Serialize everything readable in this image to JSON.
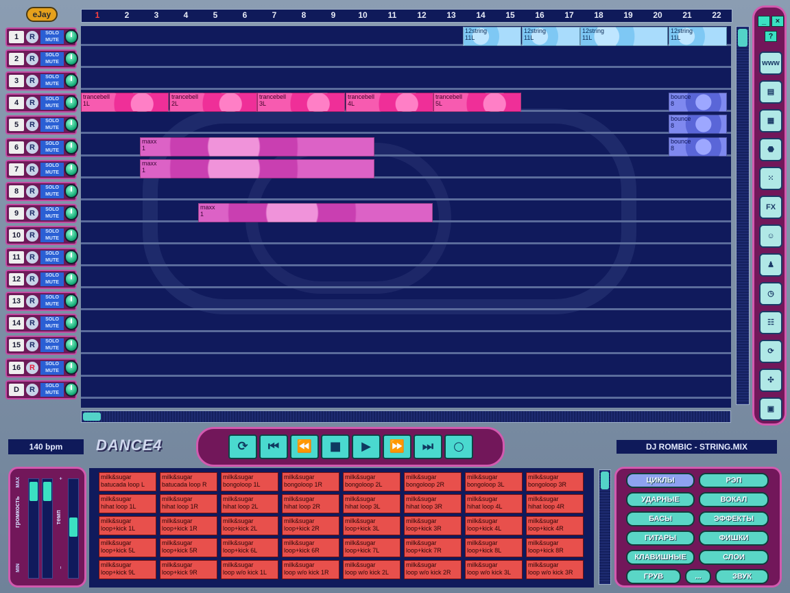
{
  "app": {
    "logo": "eJay",
    "product": "DANCE4"
  },
  "ruler": {
    "current_bar": "1",
    "bars": [
      "1",
      "2",
      "3",
      "4",
      "5",
      "6",
      "7",
      "8",
      "9",
      "10",
      "11",
      "12",
      "13",
      "14",
      "15",
      "16",
      "17",
      "18",
      "19",
      "20",
      "21",
      "22"
    ]
  },
  "tracks": [
    {
      "num": "1",
      "rec": "R"
    },
    {
      "num": "2",
      "rec": "R"
    },
    {
      "num": "3",
      "rec": "R"
    },
    {
      "num": "4",
      "rec": "R"
    },
    {
      "num": "5",
      "rec": "R"
    },
    {
      "num": "6",
      "rec": "R"
    },
    {
      "num": "7",
      "rec": "R"
    },
    {
      "num": "8",
      "rec": "R"
    },
    {
      "num": "9",
      "rec": "R"
    },
    {
      "num": "10",
      "rec": "R"
    },
    {
      "num": "11",
      "rec": "R"
    },
    {
      "num": "12",
      "rec": "R"
    },
    {
      "num": "13",
      "rec": "R"
    },
    {
      "num": "14",
      "rec": "R"
    },
    {
      "num": "15",
      "rec": "R"
    },
    {
      "num": "16",
      "rec": "R"
    },
    {
      "num": "D",
      "rec": "R"
    }
  ],
  "track_buttons": {
    "solo": "SOLO",
    "mute": "MUTE"
  },
  "clips": [
    {
      "track": 1,
      "bar_start": 14,
      "bar_len": 2,
      "name": "12string",
      "part": "11L",
      "color": "blue"
    },
    {
      "track": 1,
      "bar_start": 16,
      "bar_len": 2,
      "name": "12string",
      "part": "11L",
      "color": "blue"
    },
    {
      "track": 1,
      "bar_start": 18,
      "bar_len": 3,
      "name": "12string",
      "part": "11L",
      "color": "blue"
    },
    {
      "track": 1,
      "bar_start": 21,
      "bar_len": 2,
      "name": "12string",
      "part": "11L",
      "color": "blue"
    },
    {
      "track": 4,
      "bar_start": 1,
      "bar_len": 3,
      "name": "trancebell",
      "part": "1L",
      "color": "pink"
    },
    {
      "track": 4,
      "bar_start": 4,
      "bar_len": 3,
      "name": "trancebell",
      "part": "2L",
      "color": "pink"
    },
    {
      "track": 4,
      "bar_start": 7,
      "bar_len": 3,
      "name": "trancebell",
      "part": "3L",
      "color": "pink"
    },
    {
      "track": 4,
      "bar_start": 10,
      "bar_len": 3,
      "name": "trancebell",
      "part": "4L",
      "color": "pink"
    },
    {
      "track": 4,
      "bar_start": 13,
      "bar_len": 3,
      "name": "trancebell",
      "part": "5L",
      "color": "pink"
    },
    {
      "track": 4,
      "bar_start": 21,
      "bar_len": 2,
      "name": "bounce",
      "part": "8",
      "color": "violet"
    },
    {
      "track": 5,
      "bar_start": 21,
      "bar_len": 2,
      "name": "bounce",
      "part": "8",
      "color": "violet"
    },
    {
      "track": 6,
      "bar_start": 3,
      "bar_len": 8,
      "name": "maxx",
      "part": "1",
      "color": "magenta"
    },
    {
      "track": 6,
      "bar_start": 21,
      "bar_len": 2,
      "name": "bounce",
      "part": "8",
      "color": "violet"
    },
    {
      "track": 7,
      "bar_start": 3,
      "bar_len": 8,
      "name": "maxx",
      "part": "1",
      "color": "magenta"
    },
    {
      "track": 9,
      "bar_start": 5,
      "bar_len": 8,
      "name": "maxx",
      "part": "1",
      "color": "magenta"
    }
  ],
  "right_toolbar": {
    "close": "×",
    "minimize": "_",
    "help": "?",
    "tools": [
      {
        "name": "www-icon",
        "label": "www"
      },
      {
        "name": "notes-icon",
        "label": "▤"
      },
      {
        "name": "grid-icon",
        "label": "▦"
      },
      {
        "name": "stop-sign-icon",
        "label": "⬣"
      },
      {
        "name": "dots-icon",
        "label": "⁙"
      },
      {
        "name": "fx-icon",
        "label": "FX"
      },
      {
        "name": "face-icon",
        "label": "☺"
      },
      {
        "name": "robot-icon",
        "label": "♟"
      },
      {
        "name": "clock-icon",
        "label": "◷"
      },
      {
        "name": "mixer-icon",
        "label": "☷"
      },
      {
        "name": "refresh-icon",
        "label": "⟳"
      },
      {
        "name": "fan-icon",
        "label": "✣"
      },
      {
        "name": "save-icon",
        "label": "▣"
      }
    ]
  },
  "status": {
    "bpm": "140 bpm",
    "song": "DJ ROMBIC - STRING.MIX"
  },
  "transport": {
    "buttons": [
      {
        "name": "loop-icon",
        "glyph": "⟳"
      },
      {
        "name": "skip-start-icon",
        "glyph": "⏮"
      },
      {
        "name": "rewind-icon",
        "glyph": "⏪"
      },
      {
        "name": "stop-icon",
        "glyph": "■"
      },
      {
        "name": "play-icon",
        "glyph": "▶"
      },
      {
        "name": "fast-forward-icon",
        "glyph": "⏩"
      },
      {
        "name": "skip-end-icon",
        "glyph": "⏭"
      },
      {
        "name": "record-icon",
        "glyph": "○"
      }
    ]
  },
  "mixer": {
    "volume_label": "громкость",
    "tempo_label": "темп",
    "max": "MAX",
    "min": "MIN",
    "plus": "+",
    "minus": "−"
  },
  "loops": [
    [
      "milk&sugar",
      "batucada loop L"
    ],
    [
      "milk&sugar",
      "batucada loop R"
    ],
    [
      "milk&sugar",
      "bongoloop 1L"
    ],
    [
      "milk&sugar",
      "bongoloop 1R"
    ],
    [
      "milk&sugar",
      "bongoloop 2L"
    ],
    [
      "milk&sugar",
      "bongoloop 2R"
    ],
    [
      "milk&sugar",
      "bongoloop 3L"
    ],
    [
      "milk&sugar",
      "bongoloop 3R"
    ],
    [
      "milk&sugar",
      "hihat loop 1L"
    ],
    [
      "milk&sugar",
      "hihat loop 1R"
    ],
    [
      "milk&sugar",
      "hihat loop 2L"
    ],
    [
      "milk&sugar",
      "hihat loop 2R"
    ],
    [
      "milk&sugar",
      "hihat loop 3L"
    ],
    [
      "milk&sugar",
      "hihat loop 3R"
    ],
    [
      "milk&sugar",
      "hihat loop 4L"
    ],
    [
      "milk&sugar",
      "hihat loop 4R"
    ],
    [
      "milk&sugar",
      "loop+kick 1L"
    ],
    [
      "milk&sugar",
      "loop+kick 1R"
    ],
    [
      "milk&sugar",
      "loop+kick 2L"
    ],
    [
      "milk&sugar",
      "loop+kick 2R"
    ],
    [
      "milk&sugar",
      "loop+kick 3L"
    ],
    [
      "milk&sugar",
      "loop+kick 3R"
    ],
    [
      "milk&sugar",
      "loop+kick 4L"
    ],
    [
      "milk&sugar",
      "loop+kick 4R"
    ],
    [
      "milk&sugar",
      "loop+kick 5L"
    ],
    [
      "milk&sugar",
      "loop+kick 5R"
    ],
    [
      "milk&sugar",
      "loop+kick 6L"
    ],
    [
      "milk&sugar",
      "loop+kick 6R"
    ],
    [
      "milk&sugar",
      "loop+kick 7L"
    ],
    [
      "milk&sugar",
      "loop+kick 7R"
    ],
    [
      "milk&sugar",
      "loop+kick 8L"
    ],
    [
      "milk&sugar",
      "loop+kick 8R"
    ],
    [
      "milk&sugar",
      "loop+kick 9L"
    ],
    [
      "milk&sugar",
      "loop+kick 9R"
    ],
    [
      "milk&sugar",
      "loop w/o kick 1L"
    ],
    [
      "milk&sugar",
      "loop w/o kick 1R"
    ],
    [
      "milk&sugar",
      "loop w/o kick 2L"
    ],
    [
      "milk&sugar",
      "loop w/o kick 2R"
    ],
    [
      "milk&sugar",
      "loop w/o kick 3L"
    ],
    [
      "milk&sugar",
      "loop w/o kick 3R"
    ]
  ],
  "categories": {
    "active": "ЦИКЛЫ",
    "items": [
      "ЦИКЛЫ",
      "РЭП",
      "УДАРНЫЕ",
      "ВОКАЛ",
      "БАСЫ",
      "ЭФФЕКТЫ",
      "ГИТАРЫ",
      "ФИШКИ",
      "КЛАВИШНЫЕ",
      "СЛОИ"
    ],
    "bottom": [
      "ГРУВ",
      "...",
      "ЗВУК"
    ]
  },
  "colors": {
    "accent": "#d25aaf",
    "panel": "#72175a",
    "track_bg": "#101a5c",
    "button": "#4ad9cf"
  }
}
